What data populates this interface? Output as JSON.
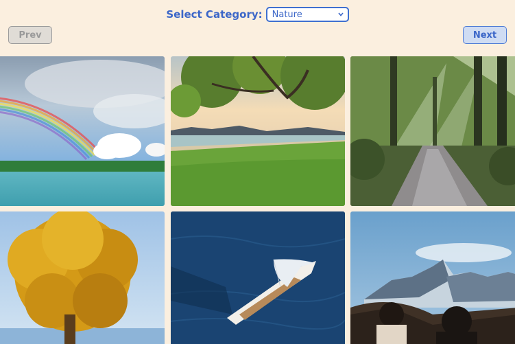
{
  "category": {
    "label": "Select Category:",
    "selected": "Nature"
  },
  "nav": {
    "prev_label": "Prev",
    "next_label": "Next"
  },
  "colors": {
    "background": "#fbefdf",
    "accent": "#3b66c8"
  },
  "gallery": [
    {
      "name": "rainbow-over-lake"
    },
    {
      "name": "tropical-beach-tree"
    },
    {
      "name": "forest-path-sunbeams"
    },
    {
      "name": "golden-autumn-tree"
    },
    {
      "name": "sailboat-aerial-ocean"
    },
    {
      "name": "mountain-hikers-view"
    }
  ]
}
